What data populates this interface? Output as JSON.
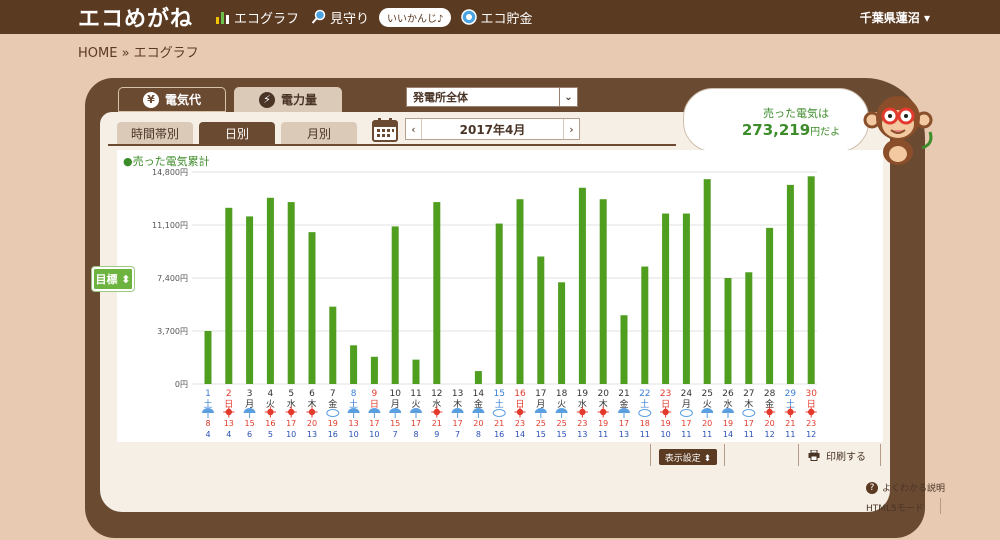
{
  "header": {
    "logo": "エコめがね",
    "nav": [
      {
        "label": "エコグラフ",
        "icon": "bar-chart-icon"
      },
      {
        "label": "見守り",
        "icon": "magnifier-icon"
      },
      {
        "label": "エコ貯金",
        "icon": "coin-icon"
      }
    ],
    "bubble": "いいかんじ♪",
    "region": "千葉県蓮沼 ▾"
  },
  "breadcrumb": "HOME » エコグラフ",
  "main_tabs": [
    {
      "label": "電気代",
      "icon": "yen-icon"
    },
    {
      "label": "電力量",
      "icon": "lightning-icon"
    }
  ],
  "plant_select": "発電所全体",
  "sub_tabs": [
    "時間帯別",
    "日別",
    "月別"
  ],
  "month_nav": {
    "prev": "‹",
    "label": "2017年4月",
    "next": "›"
  },
  "sold": {
    "line1": "売った電気は",
    "value": "273,219",
    "unit": "円だよ"
  },
  "goal_button": "目標 ⬍",
  "footer": {
    "display_settings": "表示設定 ⬍",
    "print": "印刷する",
    "help": "よくわかる説明",
    "html5": "HTML5モード"
  },
  "colors": {
    "bar": "#4f9e20",
    "weekday": "#333333",
    "saturday": "#3a7fd5",
    "sunday": "#e23b2e",
    "max_temp": "#e23b2e",
    "min_temp": "#2a4fb5"
  },
  "chart_data": {
    "type": "bar",
    "title": "●売った電気累計",
    "ylabel": "",
    "y_ticks": [
      "0円",
      "3,700円",
      "7,400円",
      "11,100円",
      "14,800円"
    ],
    "ylim": [
      0,
      14800
    ],
    "categories": [
      "1",
      "2",
      "3",
      "4",
      "5",
      "6",
      "7",
      "8",
      "9",
      "10",
      "11",
      "12",
      "13",
      "14",
      "15",
      "16",
      "17",
      "18",
      "19",
      "20",
      "21",
      "22",
      "23",
      "24",
      "25",
      "26",
      "27",
      "28",
      "29",
      "30"
    ],
    "weekdays": [
      "土",
      "日",
      "月",
      "火",
      "水",
      "木",
      "金",
      "土",
      "日",
      "月",
      "火",
      "水",
      "木",
      "金",
      "土",
      "日",
      "月",
      "火",
      "水",
      "木",
      "金",
      "土",
      "日",
      "月",
      "火",
      "水",
      "木",
      "金",
      "土",
      "日"
    ],
    "weather": [
      "rain",
      "sun",
      "rain",
      "sun",
      "sun",
      "sun",
      "cloud",
      "rain",
      "rain",
      "rain",
      "rain",
      "sun",
      "rain",
      "rain",
      "cloud",
      "sun",
      "rain",
      "rain",
      "sun",
      "sun",
      "rain",
      "cloud",
      "sun",
      "cloud",
      "rain",
      "rain",
      "cloud",
      "sun",
      "sun",
      "sun"
    ],
    "max_temp": [
      "8",
      "13",
      "15",
      "16",
      "17",
      "20",
      "19",
      "13",
      "17",
      "15",
      "17",
      "21",
      "17",
      "20",
      "21",
      "23",
      "25",
      "25",
      "23",
      "19",
      "17",
      "18",
      "19",
      "17",
      "20",
      "19",
      "17",
      "20",
      "21",
      "23"
    ],
    "min_temp": [
      "4",
      "4",
      "6",
      "5",
      "10",
      "13",
      "16",
      "10",
      "10",
      "7",
      "8",
      "9",
      "7",
      "8",
      "16",
      "14",
      "15",
      "15",
      "13",
      "11",
      "13",
      "11",
      "10",
      "11",
      "11",
      "14",
      "11",
      "12",
      "11",
      "12"
    ],
    "series": [
      {
        "name": "売った電気累計",
        "values": [
          3700,
          12300,
          11700,
          13000,
          12700,
          10600,
          5400,
          2700,
          1900,
          11000,
          1700,
          12700,
          0,
          900,
          11200,
          12900,
          8900,
          7100,
          13700,
          12900,
          4800,
          8200,
          11900,
          11900,
          14300,
          7400,
          7800,
          10900,
          13900,
          14500
        ]
      }
    ]
  }
}
